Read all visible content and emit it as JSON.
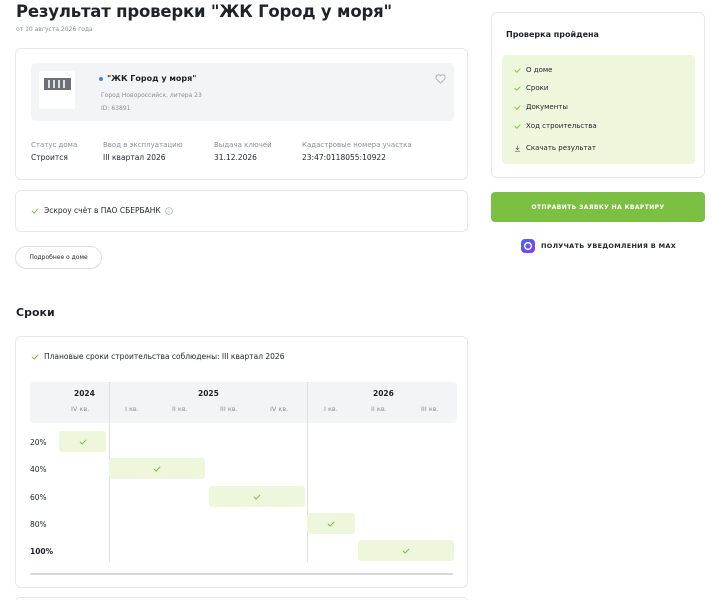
{
  "header": {
    "title": "Результат проверки \"ЖК Город у моря\"",
    "date": "от 10 августа 2026 года"
  },
  "object": {
    "name": "\"ЖК Город у моря\"",
    "address": "Город Новороссийск, литера 23",
    "id": "ID: 63891",
    "fields": [
      {
        "label": "Статус дома",
        "value": "Строится"
      },
      {
        "label": "Ввод в эксплуатацию",
        "value": "III квартал 2026"
      },
      {
        "label": "Выдача ключей",
        "value": "31.12.2026"
      },
      {
        "label": "Кадастровые номера участка",
        "value": "23:47:0118055:10922"
      }
    ]
  },
  "escrow": {
    "text": "Эскроу счёт в ПАО СБЕРБАНК"
  },
  "more_button": "Подробнее о доме",
  "schedule": {
    "title": "Сроки",
    "note": "Плановые сроки строительства соблюдены: III квартал 2026",
    "years": [
      "2024",
      "2025",
      "2026"
    ],
    "quarters": [
      "IV кв.",
      "I кв.",
      "II кв.",
      "III кв.",
      "IV кв.",
      "I кв.",
      "II кв.",
      "III кв."
    ],
    "rows": [
      "20%",
      "40%",
      "60%",
      "80%",
      "100%"
    ]
  },
  "check": {
    "title": "Проверка пройдена",
    "items": [
      "О доме",
      "Сроки",
      "Документы",
      "Ход строительства"
    ],
    "download": "Скачать результат"
  },
  "apply_button": "ОТПРАВИТЬ ЗАЯВКУ НА КВАРТИРУ",
  "notify": "ПОЛУЧАТЬ УВЕДОМЛЕНИЯ В MAX",
  "colors": {
    "accent_green": "#7bc043",
    "light_green": "#eef7dc",
    "check_green": "#7bc043",
    "dot_blue": "#3b82f6"
  }
}
